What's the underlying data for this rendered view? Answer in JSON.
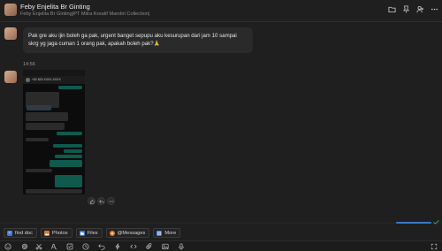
{
  "header": {
    "contact_name": "Feby Enjelita Br Ginting",
    "contact_subtitle": "Feby Enjelita Br Ginting|PT Mitra Kreatif Mandiri Collection|",
    "icons": [
      "folder-icon",
      "pin-icon",
      "add-member-icon",
      "more-icon"
    ]
  },
  "messages": [
    {
      "type": "text",
      "text": "Pak gre aku ijin boleh ga pak, urgent banget sepupu aku kesurupan dari jam 10 sampai skrg yg jaga cuman 1 orang pak, apakah boleh pak?🙏"
    },
    {
      "type": "image",
      "time": "14:56",
      "screenshot": {
        "contact": "+62 823-XXXX-XXXX",
        "bubbles": [
          "Pak gre ijin ya pak",
          "Tolong cek pesan ini",
          "Iya kenapa",
          "Boleh ga pak",
          "Ok silahkan",
          "Makasih pak"
        ]
      }
    }
  ],
  "reactions": [
    "like-icon",
    "reply-icon",
    "more-icon"
  ],
  "progress": {
    "value": 0.92,
    "color": "#3a78c9"
  },
  "quick_actions": [
    {
      "label": "find doc",
      "icon": "doc-search-icon",
      "color": "#3d7be0"
    },
    {
      "label": "Photos",
      "icon": "photo-icon",
      "color": "#e0782c"
    },
    {
      "label": "Files",
      "icon": "files-icon",
      "color": "#3d7be0"
    },
    {
      "label": "@Messages",
      "icon": "mention-icon",
      "color": "#e0782c"
    },
    {
      "label": "More",
      "icon": "grid-icon",
      "color": "#3d7be0"
    }
  ],
  "toolbar": {
    "icons": [
      "emoji-icon",
      "at-icon",
      "scissors-icon",
      "text-format-icon",
      "check-icon",
      "clock-icon",
      "undo-icon",
      "lightning-icon",
      "code-icon",
      "attachment-icon",
      "image-icon",
      "voice-icon",
      "expand-icon"
    ]
  }
}
